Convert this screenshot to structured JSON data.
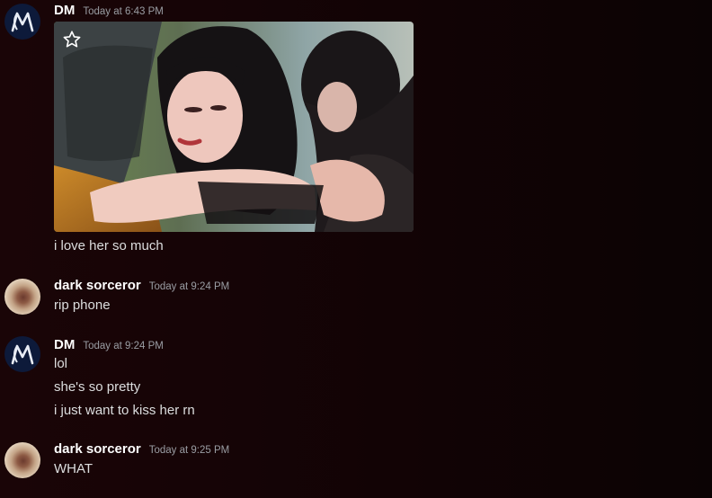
{
  "messages": [
    {
      "author": "DM",
      "time": "Today at 6:43 PM",
      "avatar_icon": "dm-logo-icon",
      "attachment_icon": "star-icon",
      "lines": [
        "i love her so much"
      ]
    },
    {
      "author": "dark sorceror",
      "time": "Today at 9:24 PM",
      "avatar_icon": "user-avatar",
      "lines": [
        "rip phone"
      ]
    },
    {
      "author": "DM",
      "time": "Today at 9:24 PM",
      "avatar_icon": "dm-logo-icon",
      "lines": [
        "lol",
        "she's so pretty",
        "i just want to kiss her rn"
      ]
    },
    {
      "author": "dark sorceror",
      "time": "Today at 9:25 PM",
      "avatar_icon": "user-avatar",
      "lines": [
        "WHAT"
      ]
    }
  ],
  "colors": {
    "background": "#150406",
    "username": "#ffffff",
    "timestamp": "#9a9da3",
    "message_text": "#dcddde",
    "dm_avatar_bg": "#0d1a3a"
  }
}
